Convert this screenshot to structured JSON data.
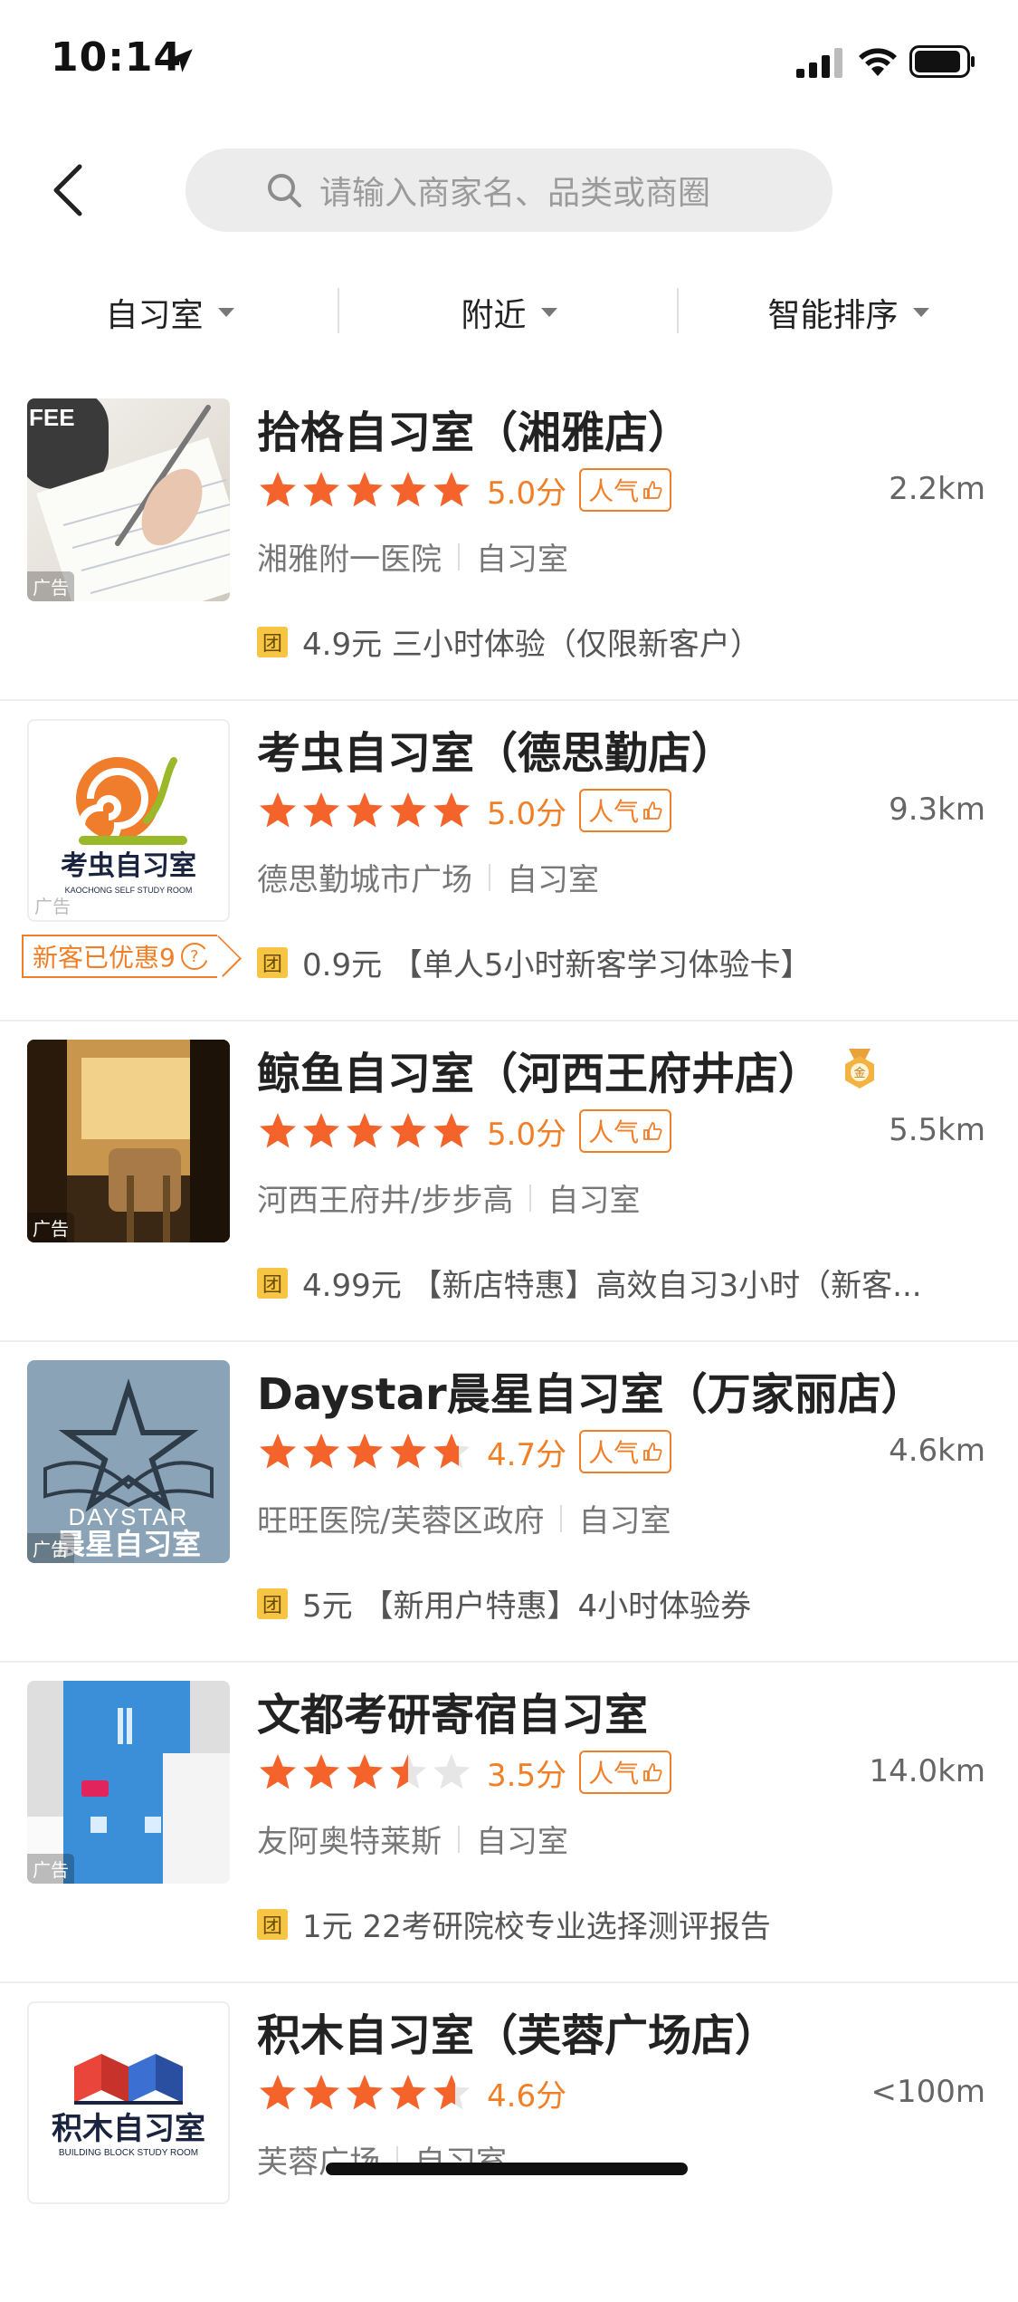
{
  "status_bar": {
    "time": "10:14"
  },
  "search": {
    "placeholder": "请输入商家名、品类或商圈"
  },
  "filters": [
    {
      "label": "自习室"
    },
    {
      "label": "附近"
    },
    {
      "label": "智能排序"
    }
  ],
  "ad_label": "广告",
  "hot_label": "人气",
  "tuan_label": "团",
  "colors": {
    "accent": "#f07f28",
    "star": "#f4642a",
    "star_empty": "#e6e6e6",
    "tuan_bg": "#f6c543"
  },
  "shops": [
    {
      "name": "拾格自习室（湘雅店）",
      "rating": 5.0,
      "score_text": "5.0分",
      "hot": true,
      "distance": "2.2km",
      "area": "湘雅附一医院",
      "category": "自习室",
      "deal": "4.9元 三小时体验（仅限新客户）",
      "ad": true,
      "thumb": "coffee-writing-photo"
    },
    {
      "name": "考虫自习室（德思勤店）",
      "rating": 5.0,
      "score_text": "5.0分",
      "hot": true,
      "distance": "9.3km",
      "area": "德思勤城市广场",
      "category": "自习室",
      "deal": "0.9元 【单人5小时新客学习体验卡】",
      "ad": true,
      "new_customer_badge": "新客已优惠9",
      "thumb": "kaochong-logo",
      "logo_text": "考虫自习室",
      "logo_sub": "KAOCHONG SELF STUDY ROOM"
    },
    {
      "name": "鲸鱼自习室（河西王府井店）",
      "rating": 5.0,
      "score_text": "5.0分",
      "hot": true,
      "distance": "5.5km",
      "area": "河西王府井/步步高",
      "category": "自习室",
      "deal": "4.99元 【新店特惠】高效自习3小时（新客...",
      "ad": true,
      "medal_text": "金",
      "thumb": "study-booth-photo"
    },
    {
      "name": "Daystar晨星自习室（万家丽店）",
      "rating": 4.7,
      "score_text": "4.7分",
      "hot": true,
      "distance": "4.6km",
      "area": "旺旺医院/芙蓉区政府",
      "category": "自习室",
      "deal": "5元 【新用户特惠】4小时体验券",
      "ad": true,
      "thumb": "daystar-logo",
      "logo_text": "DAYSTAR",
      "logo_sub": "晨星自习室"
    },
    {
      "name": "文都考研寄宿自习室",
      "rating": 3.5,
      "score_text": "3.5分",
      "hot": true,
      "distance": "14.0km",
      "area": "友阿奥特莱斯",
      "category": "自习室",
      "deal": "1元 22考研院校专业选择测评报告",
      "ad": true,
      "thumb": "book-photo"
    },
    {
      "name": "积木自习室（芙蓉广场店）",
      "rating": 4.6,
      "score_text": "4.6分",
      "hot": false,
      "distance": "<100m",
      "area": "芙蓉广场",
      "category": "自习室",
      "deal": "",
      "ad": false,
      "thumb": "jimu-logo",
      "logo_text": "积木自习室",
      "logo_sub": "BUILDING BLOCK STUDY ROOM"
    }
  ]
}
